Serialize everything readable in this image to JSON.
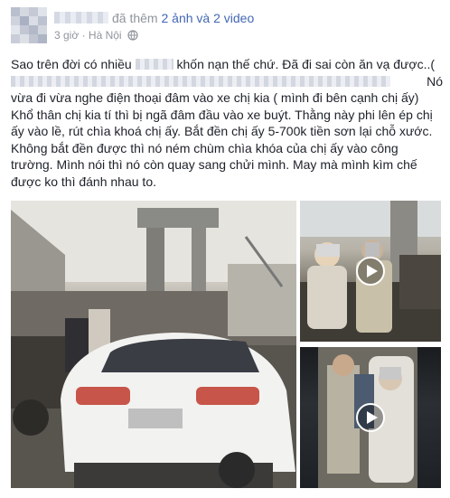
{
  "post": {
    "action_text": "đã thêm",
    "action_link": "2 ảnh và 2 video",
    "time": "3 giờ",
    "separator": "·",
    "location": "Hà Nội",
    "privacy_icon": "globe-icon",
    "body": {
      "line1_a": "Sao trên đời có nhiều",
      "line1_b": "khốn nạn thế chứ. Đã đi sai còn ăn vạ được..(",
      "line2_end": "Nó",
      "rest": "vừa đi vừa nghe điện thoại đâm vào xe chị kia ( mình đi bên cạnh chị ấy) Khổ thân chị kia tí thì bị ngã đâm đầu vào xe buýt. Thằng này phi lên ép chị ấy vào lề, rút chìa khoá chị ấy. Bắt đền chị ấy 5-700k tiền sơn lại chỗ xước. Không bắt đền được thì nó ném chùm chìa khóa của chị ấy vào công trường. Mình nói thì nó còn quay sang chửi mình. May mà mình kìm chế được ko thì đánh nhau to."
    },
    "media": [
      {
        "type": "photo",
        "description": "white-sedan-street-photo"
      },
      {
        "type": "video",
        "description": "roadside-argument-video-1"
      },
      {
        "type": "video",
        "description": "roadside-argument-video-2"
      }
    ]
  },
  "colors": {
    "link": "#4267b2",
    "meta": "#90949c",
    "text": "#1d2129"
  }
}
